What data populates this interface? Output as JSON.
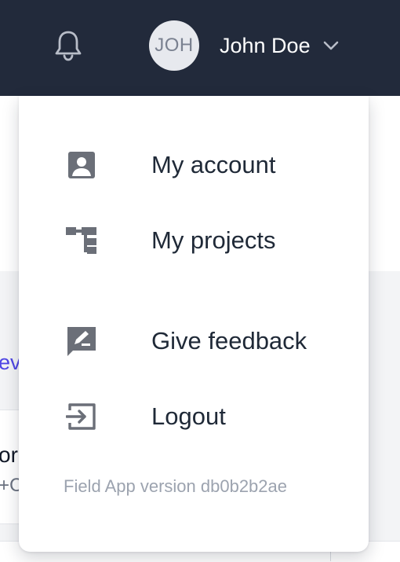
{
  "header": {
    "background": "#222a3b",
    "notifications_icon": "bell-icon",
    "user": {
      "avatar_initials": "JOH",
      "name": "John Doe",
      "menu_icon": "chevron-down-icon"
    }
  },
  "background_page": {
    "link_fragment": "ev",
    "card_title_fragment": "or",
    "card_subtitle_fragment": "+C"
  },
  "dropdown": {
    "items": [
      {
        "label": "My account",
        "icon": "account-box-icon"
      },
      {
        "label": "My projects",
        "icon": "project-tree-icon"
      },
      {
        "label": "Give feedback",
        "icon": "feedback-icon"
      },
      {
        "label": "Logout",
        "icon": "logout-icon"
      }
    ],
    "version": "Field App version db0b2b2ae"
  },
  "colors": {
    "accent_link": "#4f46e5",
    "menu_text": "#1f2937",
    "icon": "#6b6f78",
    "muted": "#9ca3af"
  }
}
